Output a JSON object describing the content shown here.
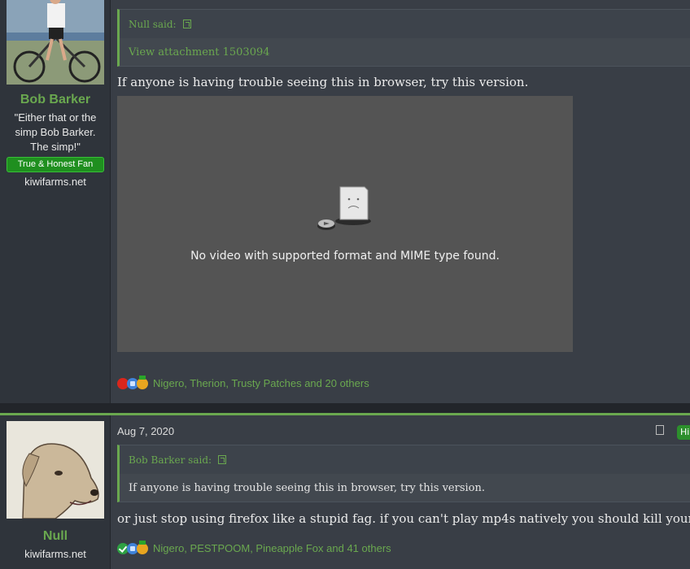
{
  "post1": {
    "username": "Bob Barker",
    "user_quote": "\"Either that or the simp Bob Barker. The simp!\"",
    "banner": "True & Honest Fan",
    "site": "kiwifarms.net",
    "quote_author": "Null said:",
    "quote_link": "View attachment 1503094",
    "body": "If anyone is having trouble seeing this in browser, try this version.",
    "video_message": "No video with supported format and MIME type found.",
    "reactions": "Nigero, Therion, Trusty Patches",
    "reactions_others": " and 20 others"
  },
  "post2": {
    "username": "Null",
    "site": "kiwifarms.net",
    "date": "Aug 7, 2020",
    "badge": "Hi",
    "quote_author": "Bob Barker said:",
    "quote_text": "If anyone is having trouble seeing this in browser, try this version.",
    "body": "or just stop using firefox like a stupid fag. if you can't play mp4s natively you should kill yourself.",
    "reactions": "Nigero, PESTPOOM, Pineapple Fox",
    "reactions_others": " and 41 others"
  },
  "colors": {
    "accent": "#6aa84f",
    "post_bg": "#393e46",
    "sidebar_bg": "#2f343b",
    "banner_bg": "#1f8f1f"
  },
  "icons": [
    "arrow-up-icon",
    "sad-file-icon",
    "heart-icon",
    "like-icon",
    "medal-icon",
    "check-icon",
    "share-icon"
  ]
}
